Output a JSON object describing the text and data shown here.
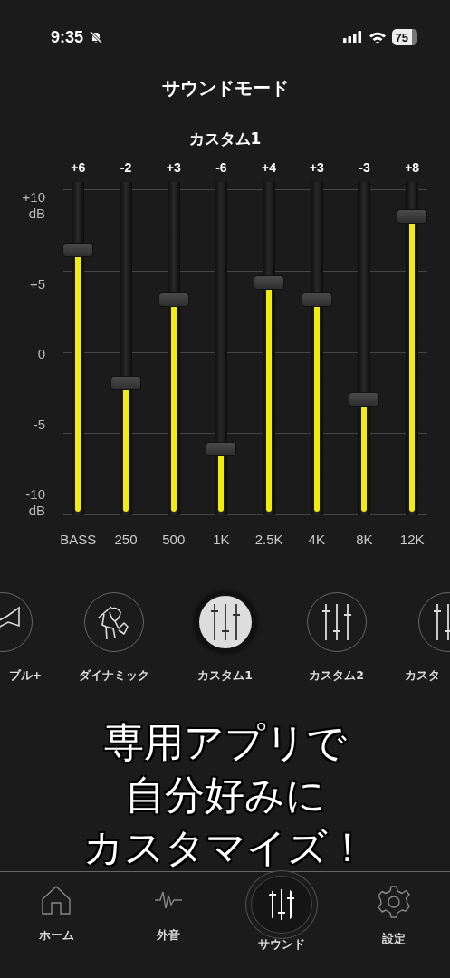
{
  "status_bar": {
    "time": "9:35",
    "battery": "75"
  },
  "title": "サウンドモード",
  "preset_name": "カスタム1",
  "axis_labels": [
    {
      "text": "+10",
      "unit": "dB"
    },
    {
      "text": "+5"
    },
    {
      "text": "0"
    },
    {
      "text": "-5"
    },
    {
      "text": "-10",
      "unit": "dB"
    }
  ],
  "bands": [
    {
      "name": "BASS",
      "reading": "+6",
      "level": 0.8
    },
    {
      "name": "250",
      "reading": "-2",
      "level": 0.4
    },
    {
      "name": "500",
      "reading": "+3",
      "level": 0.65
    },
    {
      "name": "1K",
      "reading": "-6",
      "level": 0.2
    },
    {
      "name": "2.5K",
      "reading": "+4",
      "level": 0.7
    },
    {
      "name": "4K",
      "reading": "+3",
      "level": 0.65
    },
    {
      "name": "8K",
      "reading": "-3",
      "level": 0.35
    },
    {
      "name": "12K",
      "reading": "+8",
      "level": 0.9
    }
  ],
  "modes": [
    {
      "label": "ブル+",
      "kind": "trumpet",
      "selected": false
    },
    {
      "label": "ダイナミック",
      "kind": "dancer",
      "selected": false
    },
    {
      "label": "カスタム1",
      "kind": "custom",
      "selected": true
    },
    {
      "label": "カスタム2",
      "kind": "custom",
      "selected": false
    },
    {
      "label": "カスタ",
      "kind": "custom",
      "selected": false
    }
  ],
  "caption": [
    "専用アプリで",
    "自分好みに",
    "カスタマイズ！"
  ],
  "nav": [
    {
      "label": "ホーム",
      "kind": "home",
      "selected": false
    },
    {
      "label": "外音",
      "kind": "ambient",
      "selected": false
    },
    {
      "label": "サウンド",
      "kind": "sound",
      "selected": true
    },
    {
      "label": "設定",
      "kind": "settings",
      "selected": false
    }
  ]
}
